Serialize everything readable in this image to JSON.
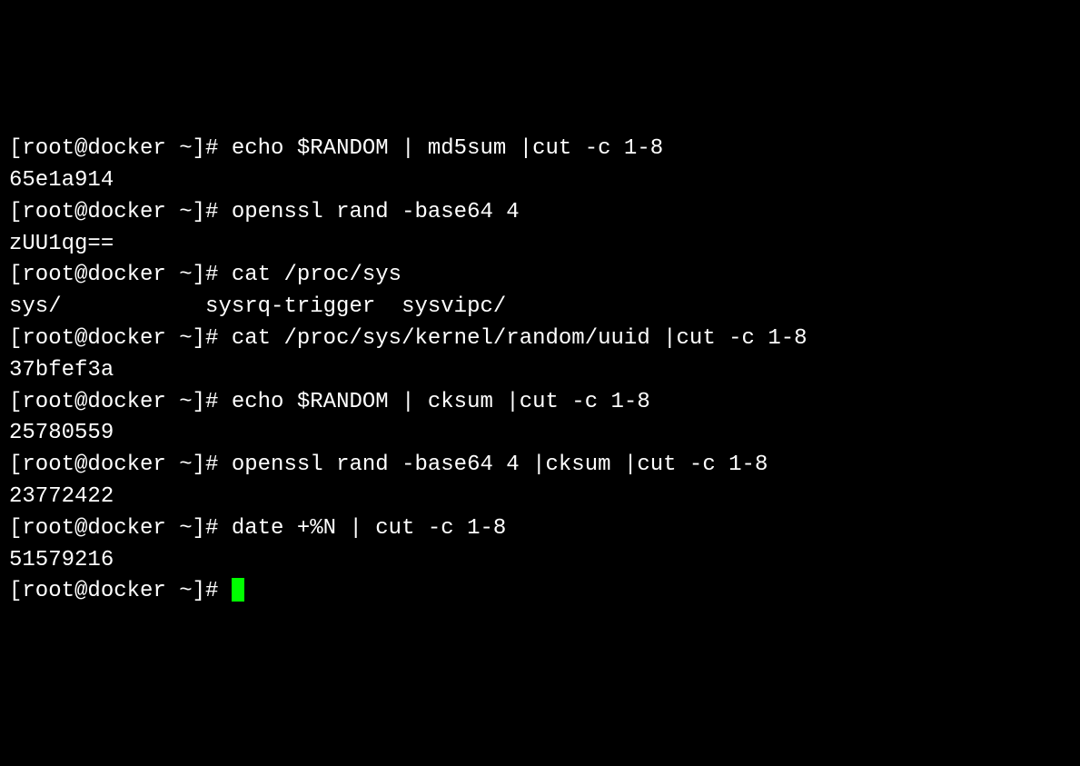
{
  "prompt": "[root@docker ~]# ",
  "lines": {
    "l0": "echo $RANDOM | md5sum |cut -c 1-8",
    "l1": "65e1a914",
    "l2": "openssl rand -base64 4",
    "l3": "zUU1qg==",
    "l4": "cat /proc/sys",
    "l5": "sys/           sysrq-trigger  sysvipc/       ",
    "l6": "cat /proc/sys/kernel/random/uuid |cut -c 1-8",
    "l7": "37bfef3a",
    "l8": "echo $RANDOM | cksum |cut -c 1-8",
    "l9": "25780559",
    "l10": "openssl rand -base64 4 |cksum |cut -c 1-8",
    "l11": "23772422",
    "l12": "date +%N | cut -c 1-8",
    "l13": "51579216",
    "l14": ""
  }
}
